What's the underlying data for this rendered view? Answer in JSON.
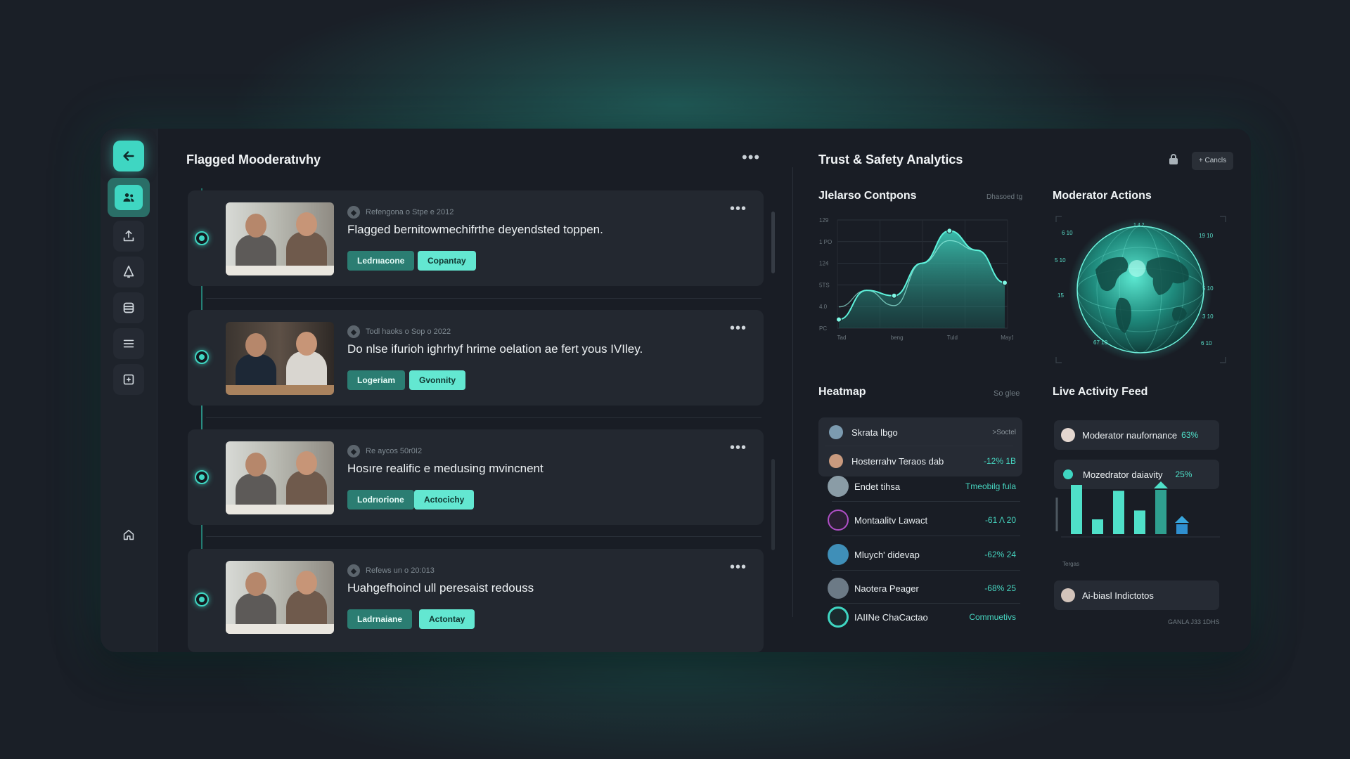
{
  "sidebar": {
    "items": [
      "back",
      "users",
      "upload",
      "alerts",
      "archive",
      "menu",
      "add",
      "home"
    ]
  },
  "flagged": {
    "title": "Flagged Mooderatıvhy",
    "cards": [
      {
        "meta": "Refengona o Stpe e 2012",
        "text": "Flagged bernitowmechifrthe deyendsted toppen.",
        "tag1": "Ledrııacone",
        "tag2": "Copantay"
      },
      {
        "meta": "Todl haoks o Sop o 2022",
        "text": "Do nlse ifurioh ighrhyf hrime oelation ae fert yous IVIley.",
        "tag1": "Logeriam",
        "tag2": "Gvonnity"
      },
      {
        "meta": "Re aycos 50r0I2",
        "text": "Hosıre realific e medusing mvincnent",
        "tag1": "Lodrıorione",
        "tag2": "Actocichy"
      },
      {
        "meta": "Refews un o 20:013",
        "text": "Ƕahgefhoincl ull peresaist redouss",
        "tag1": "Ladrnaiane",
        "tag2": "Actontay"
      }
    ]
  },
  "analytics": {
    "title": "Trust & Safety Analytics",
    "cancel_label": "+ Cancls",
    "lock_icon": "lock-icon"
  },
  "line_panel": {
    "title": "Jlelarso Contpons",
    "subtitle": "Dhasoed tg"
  },
  "moderator_actions": {
    "title": "Moderator Actions",
    "globe_labels": [
      "6 10",
      "1.4 2",
      "19 10",
      "5 10",
      "15",
      "5 10",
      "3 10",
      "6 10",
      "67 10"
    ]
  },
  "chart_data": {
    "type": "area",
    "ylabels": [
      "129",
      "1 PO",
      "124",
      "5TS",
      "4.0",
      "PC"
    ],
    "xlabels": [
      "Tad",
      "beng",
      "Tuld",
      "May1"
    ],
    "x": [
      0,
      1,
      2,
      3,
      4,
      5,
      6
    ],
    "y": [
      0.08,
      0.35,
      0.3,
      0.6,
      0.9,
      0.72,
      0.42
    ]
  },
  "heatmap": {
    "title": "Heatmap",
    "link": "So glee",
    "rows": [
      {
        "name": "Skrata lbgo",
        "value": ">Soctel"
      },
      {
        "name": "Hosterrahv Teraos dab",
        "value": "-12% 1B"
      },
      {
        "name": "Endet tihsa",
        "value": "Tmeobilg fula"
      },
      {
        "name": "Montaalitv Lawact",
        "value": "-61 Λ 20"
      },
      {
        "name": "Mluych' didevap",
        "value": "-62% 24"
      },
      {
        "name": "Naotera Peager",
        "value": "-68% 25"
      },
      {
        "name": "IAIINe ChaCactao",
        "value": "Commuetivs"
      }
    ]
  },
  "feed": {
    "title": "Live Activity Feed",
    "items": [
      {
        "label": "Moderator naufornance",
        "pct": "63%"
      },
      {
        "label": "Mozedrator daiavity",
        "pct": "25%"
      },
      {
        "label": "Ai-biasl Indictotos",
        "pct": ""
      }
    ],
    "axis_label": "Tergas",
    "footer": "GANLA  J33 1DHS",
    "bar_values": [
      1.0,
      0.3,
      0.88,
      0.48,
      0.9,
      0.2
    ]
  },
  "colors": {
    "accent": "#3fd6c2",
    "accent_light": "#63e7d1",
    "accent_dark": "#2b7d72",
    "background": "#191d25"
  }
}
